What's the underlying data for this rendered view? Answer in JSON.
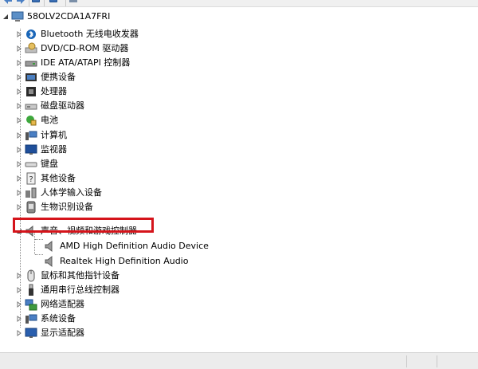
{
  "toolbar": {
    "icons": [
      "back-icon",
      "forward-icon",
      "properties-icon",
      "help-icon",
      "scan-icon"
    ]
  },
  "tree": {
    "root": {
      "label": "58OLV2CDA1A7FRI",
      "icon": "computer-icon"
    },
    "categories": [
      {
        "label": "Bluetooth 无线电收发器",
        "icon": "bluetooth-icon",
        "expanded": false
      },
      {
        "label": "DVD/CD-ROM 驱动器",
        "icon": "dvd-drive-icon",
        "expanded": false
      },
      {
        "label": "IDE ATA/ATAPI 控制器",
        "icon": "ide-controller-icon",
        "expanded": false
      },
      {
        "label": "便携设备",
        "icon": "portable-device-icon",
        "expanded": false
      },
      {
        "label": "处理器",
        "icon": "processor-icon",
        "expanded": false
      },
      {
        "label": "磁盘驱动器",
        "icon": "disk-drive-icon",
        "expanded": false
      },
      {
        "label": "电池",
        "icon": "battery-icon",
        "expanded": false
      },
      {
        "label": "计算机",
        "icon": "computer-icon",
        "expanded": false
      },
      {
        "label": "监视器",
        "icon": "monitor-icon",
        "expanded": false
      },
      {
        "label": "键盘",
        "icon": "keyboard-icon",
        "expanded": false
      },
      {
        "label": "其他设备",
        "icon": "other-devices-icon",
        "expanded": false
      },
      {
        "label": "人体学输入设备",
        "icon": "hid-icon",
        "expanded": false
      },
      {
        "label": "生物识别设备",
        "icon": "biometric-icon",
        "expanded": false
      },
      {
        "label": "声音、视频和游戏控制器",
        "icon": "speaker-icon",
        "expanded": true,
        "children": [
          {
            "label": "AMD High Definition Audio Device",
            "icon": "speaker-icon"
          },
          {
            "label": "Realtek High Definition Audio",
            "icon": "speaker-icon"
          }
        ]
      },
      {
        "label": "鼠标和其他指针设备",
        "icon": "mouse-icon",
        "expanded": false
      },
      {
        "label": "通用串行总线控制器",
        "icon": "usb-icon",
        "expanded": false
      },
      {
        "label": "网络适配器",
        "icon": "network-adapter-icon",
        "expanded": false
      },
      {
        "label": "系统设备",
        "icon": "system-device-icon",
        "expanded": false
      },
      {
        "label": "显示适配器",
        "icon": "display-adapter-icon",
        "expanded": false
      }
    ]
  },
  "colors": {
    "highlight": "#d5141b",
    "tree_line": "#8a8a8a",
    "toolbar_bg": "#f0f0f0",
    "status_bg": "#ececec"
  }
}
